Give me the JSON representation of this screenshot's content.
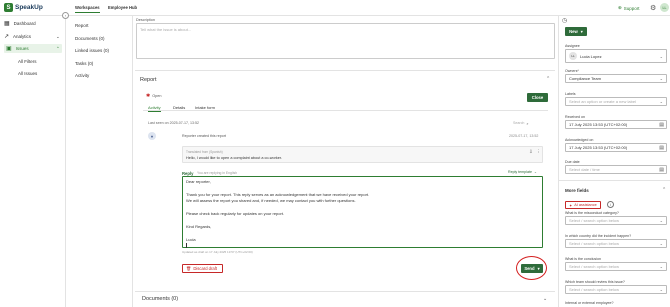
{
  "app": {
    "logo": "SpeakUp"
  },
  "top_tabs": [
    "Workspaces",
    "Employee Hub"
  ],
  "top_right": {
    "support": "Support",
    "avatar": "LL"
  },
  "sidebar": {
    "items": [
      {
        "label": "Dashboard"
      },
      {
        "label": "Analytics"
      },
      {
        "label": "Issues"
      }
    ],
    "sub_items": [
      "All Filters",
      "All Issues"
    ]
  },
  "subnav": [
    "Report",
    "Documents (0)",
    "Linked issues (0)",
    "Tasks (0)",
    "Activity"
  ],
  "description": {
    "label": "Description",
    "placeholder": "Tell what the issue is about..."
  },
  "report": {
    "title": "Report",
    "status": "Open",
    "close_button": "Close",
    "tabs": [
      "Activity",
      "Details",
      "Intake form"
    ],
    "last_seen": "Last seen on 2025-07-17, 13:52",
    "search_placeholder": "Search",
    "activity": {
      "text": "Reporter created this report",
      "timestamp": "2025-07-17, 13:52",
      "quote_meta": "Translated from (Spanish)",
      "quote_text": "Hello, I would like to open a complaint about a co-worker."
    },
    "reply": {
      "label": "Reply",
      "meta": "You are replying in English",
      "template": "Reply template",
      "lines": [
        "Dear reporter,",
        "",
        "Thank you for your report. This reply serves as an acknowledgement that we have received your report.",
        "We will assess the report you shared and, if needed, we may contact you with further questions.",
        "",
        "Please check back regularly for updates on your report.",
        "",
        "Kind Regards,",
        "",
        "Lucia"
      ],
      "draft_saved": "Updated as draft on 17 July 2025 13:57 (UTC+02:00)",
      "discard": "Discard draft",
      "send": "Send"
    }
  },
  "documents": {
    "title": "Documents (0)"
  },
  "right": {
    "new_button": "New",
    "assignee": {
      "label": "Assignee",
      "value": "Lucia Lopez",
      "avatar": "LL"
    },
    "owners": {
      "label": "Owners*",
      "value": "Compliance Team"
    },
    "labels": {
      "label": "Labels",
      "placeholder": "Select an option or create a new label"
    },
    "received": {
      "label": "Received on",
      "value": "17 July 2025 13:53 (UTC+02:00)"
    },
    "acknowledged": {
      "label": "Acknowledged on",
      "value": "17 July 2025 13:53 (UTC+02:00)"
    },
    "due": {
      "label": "Due date",
      "placeholder": "Select date / time"
    },
    "more_fields": "More fields",
    "ai_button": "AI assistance",
    "fields": [
      {
        "label": "What is the misconduct category?",
        "placeholder": "Select / search option below"
      },
      {
        "label": "In which country did the incident happen?",
        "placeholder": "Select / search option below"
      },
      {
        "label": "What is the conclusion",
        "placeholder": "Select / search option below"
      },
      {
        "label": "Which team should review this issue?",
        "placeholder": "Select / search option below"
      },
      {
        "label": "Internal or external employee?"
      }
    ]
  }
}
